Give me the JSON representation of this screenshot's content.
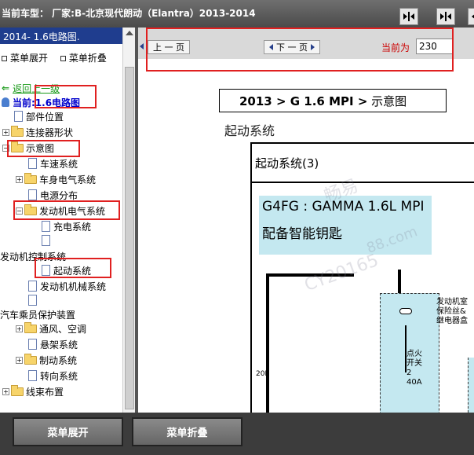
{
  "window": {
    "title": "当前车型：  厂家:B-北京现代朗动（Elantra）2013-2014"
  },
  "left_panel": {
    "header": "2014- 1.6电路图.",
    "expand_link": "菜单展开",
    "collapse_link": "菜单折叠",
    "back_link": "返回上一级",
    "current": "当前:1.6电路图"
  },
  "tree": {
    "items": [
      {
        "label": "部件位置"
      },
      {
        "label": "连接器形状"
      },
      {
        "label": "示意图"
      },
      {
        "label": "车速系统"
      },
      {
        "label": "车身电气系统"
      },
      {
        "label": "电源分布"
      },
      {
        "label": "发动机电气系统"
      },
      {
        "label": "充电系统"
      },
      {
        "label": "发动机控制系统"
      },
      {
        "label": "起动系统"
      },
      {
        "label": "发动机机械系统"
      },
      {
        "label": "汽车乘员保护装置"
      },
      {
        "label": "通风、空调"
      },
      {
        "label": "悬架系统"
      },
      {
        "label": "制动系统"
      },
      {
        "label": "转向系统"
      },
      {
        "label": "线束布置"
      }
    ]
  },
  "nav": {
    "prev_label": "上 一 页",
    "next_label": "下 一 页",
    "current_page_label": "当前为",
    "current_page_value": "230"
  },
  "document": {
    "breadcrumb_bold": "2013 > G 1.6 MPI >",
    "breadcrumb_rest": " 示意图",
    "section_title": "起动系统",
    "diagram_title": "起动系统(3)",
    "engine_line1": "G4FG : GAMMA 1.6L MPI",
    "engine_line2": "配备智能钥匙",
    "fuse_box_label": "发动机室保险丝&继电器盒",
    "ignition_label": "点火开关2 40A",
    "wire_label": "20B",
    "watermark_1": "畅易",
    "watermark_2": "CY20165",
    "watermark_3": "88.com"
  },
  "bottom": {
    "expand_button": "菜单展开",
    "collapse_button": "菜单折叠"
  },
  "colors": {
    "title_bar": "#555555",
    "left_header": "#1f3d8e",
    "highlight": "#e02020",
    "back_link": "#1a9a1a",
    "current_link": "#0000cc",
    "diagram_blue": "#c4e8f0"
  }
}
